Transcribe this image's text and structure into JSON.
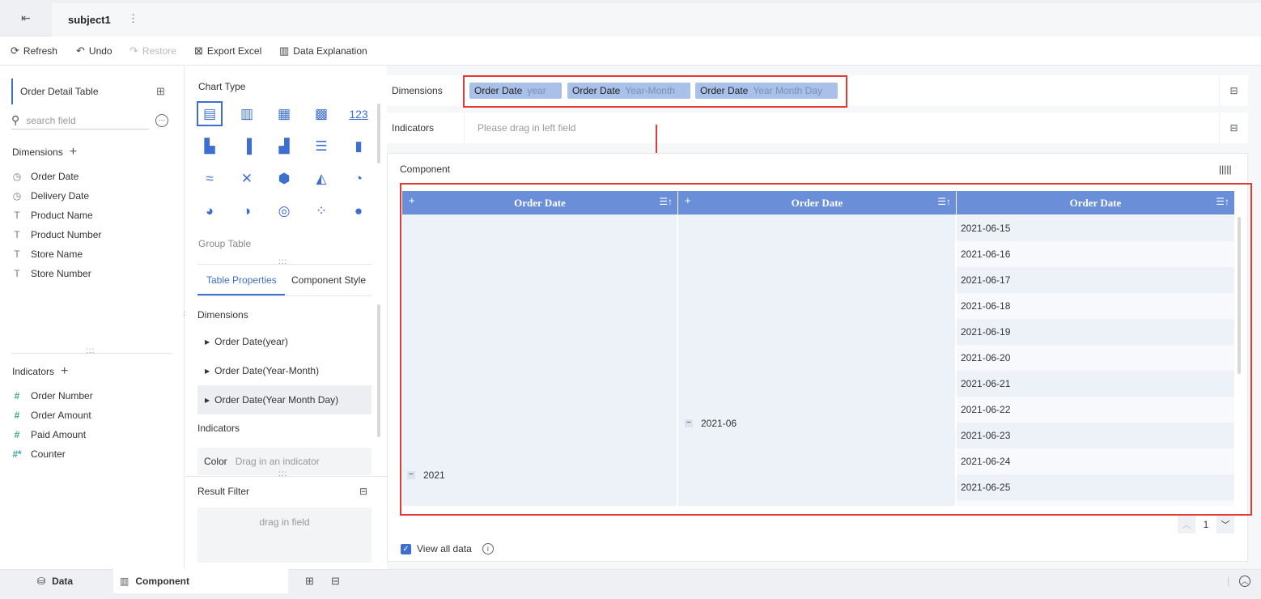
{
  "tabs": {
    "title": "subject1",
    "more": "⋮",
    "exit_icon": "exit-icon"
  },
  "toolbar": {
    "refresh": "Refresh",
    "undo": "Undo",
    "restore": "Restore",
    "export": "Export Excel",
    "explain": "Data Explanation"
  },
  "left": {
    "table_name": "Order Detail Table",
    "search_placeholder": "search field",
    "dimensions_title": "Dimensions",
    "dimensions": [
      {
        "name": "Order Date",
        "type": "date"
      },
      {
        "name": "Delivery Date",
        "type": "date"
      },
      {
        "name": "Product Name",
        "type": "text"
      },
      {
        "name": "Product Number",
        "type": "text"
      },
      {
        "name": "Store Name",
        "type": "text"
      },
      {
        "name": "Store Number",
        "type": "text"
      }
    ],
    "indicators_title": "Indicators",
    "indicators": [
      {
        "name": "Order Number",
        "type": "number"
      },
      {
        "name": "Order Amount",
        "type": "number"
      },
      {
        "name": "Paid Amount",
        "type": "number"
      },
      {
        "name": "Counter",
        "type": "counter"
      }
    ]
  },
  "middle": {
    "chart_type_title": "Chart Type",
    "group_table_label": "Group Table",
    "tab_table_properties": "Table Properties",
    "tab_component_style": "Component Style",
    "dimensions_title": "Dimensions",
    "dimension_items": [
      "Order Date(year)",
      "Order Date(Year-Month)",
      "Order Date(Year Month Day)"
    ],
    "indicators_title": "Indicators",
    "color_label": "Color",
    "color_drag": "Drag in an indicator",
    "result_filter_title": "Result Filter",
    "drag_in_field": "drag in field"
  },
  "shelves": {
    "dimensions_label": "Dimensions",
    "pills": [
      {
        "name": "Order Date",
        "sub": "year"
      },
      {
        "name": "Order Date",
        "sub": "Year-Month"
      },
      {
        "name": "Order Date",
        "sub": "Year Month Day"
      }
    ],
    "indicators_label": "Indicators",
    "indicators_placeholder": "Please drag in left field"
  },
  "component": {
    "title": "Component",
    "headers": [
      "Order Date",
      "Order Date",
      "Order Date"
    ],
    "year": "2021",
    "month": "2021-06",
    "days": [
      "2021-06-15",
      "2021-06-16",
      "2021-06-17",
      "2021-06-18",
      "2021-06-19",
      "2021-06-20",
      "2021-06-21",
      "2021-06-22",
      "2021-06-23",
      "2021-06-24",
      "2021-06-25"
    ],
    "page": "1",
    "view_all": "View all data"
  },
  "bottom": {
    "data_tab": "Data",
    "component_tab": "Component"
  },
  "colors": {
    "accent": "#3d6fd1",
    "header": "#6a8fd8",
    "highlight": "#e53935"
  }
}
